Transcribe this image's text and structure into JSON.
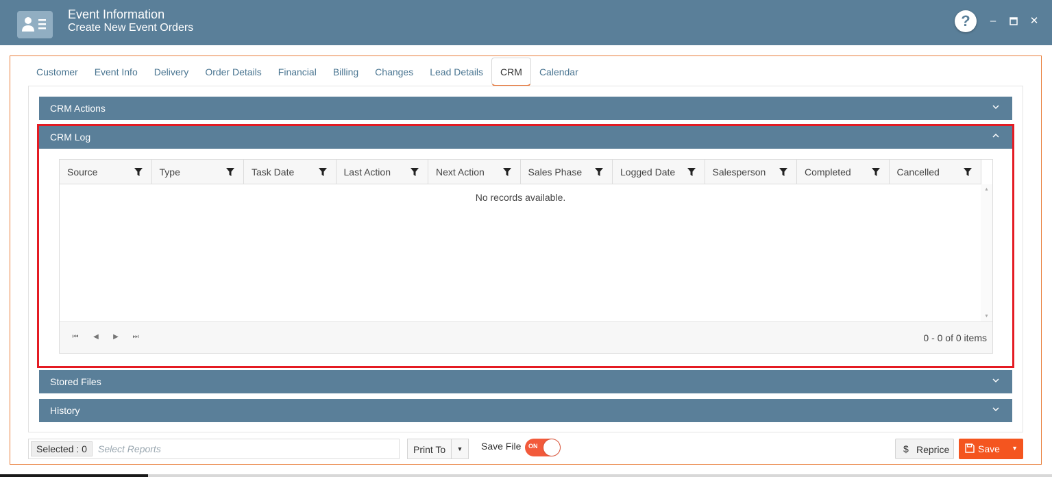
{
  "header": {
    "title": "Event Information",
    "subtitle": "Create New Event Orders",
    "help_label": "?",
    "minimize_label": "–",
    "maximize_label": "▭",
    "close_label": "✕"
  },
  "tabs": [
    {
      "label": "Customer"
    },
    {
      "label": "Event Info"
    },
    {
      "label": "Delivery"
    },
    {
      "label": "Order Details"
    },
    {
      "label": "Financial"
    },
    {
      "label": "Billing"
    },
    {
      "label": "Changes"
    },
    {
      "label": "Lead Details"
    },
    {
      "label": "CRM",
      "active": true
    },
    {
      "label": "Calendar"
    }
  ],
  "sections": {
    "crm_actions": "CRM Actions",
    "crm_log": "CRM Log",
    "stored_files": "Stored Files",
    "history": "History"
  },
  "crm_log_grid": {
    "columns": [
      "Source",
      "Type",
      "Task Date",
      "Last Action",
      "Next Action",
      "Sales Phase",
      "Logged Date",
      "Salesperson",
      "Completed",
      "Cancelled"
    ],
    "empty_message": "No records available.",
    "pager_info": "0 - 0 of 0 items"
  },
  "footer": {
    "selected_label": "Selected : 0",
    "reports_placeholder": "Select Reports",
    "print_to_label": "Print To",
    "save_file_label": "Save File",
    "save_file_toggle": "ON",
    "reprice_icon": "$",
    "reprice_label": "Reprice",
    "save_label": "Save"
  },
  "colors": {
    "header_bg": "#5a7f99",
    "accent": "#f4551f",
    "highlight": "#e41b23",
    "tab_text": "#4a7591"
  }
}
